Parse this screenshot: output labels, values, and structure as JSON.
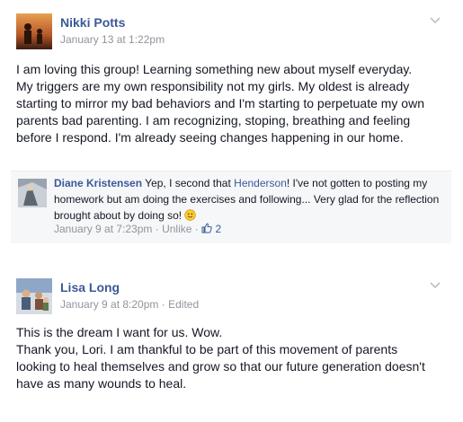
{
  "post1": {
    "author": "Nikki Potts",
    "timestamp": "January 13 at 1:22pm",
    "text_lines": [
      "I am loving this group! Learning something new about myself everyday.",
      "My triggers are my own responsibility not my girls. My oldest is already",
      "starting to mirror my bad behaviors and I'm starting to perpetuate my own",
      "parents bad parenting. I am recognizing, stoping, breathing and feeling",
      "before I respond. I'm already seeing changes happening in our home."
    ]
  },
  "comment": {
    "author": "Diane Kristensen",
    "text_before_mention": "Yep, I second that",
    "mention": "Henderson",
    "text_line1_rest": "! I've not gotten to posting",
    "text_line2": "my homework but am doing the exercises and following... Very glad for the",
    "text_line3": "reflection brought about by doing so!",
    "emoji": "smile-emoji",
    "timestamp": "January 9 at 7:23pm",
    "separator": "·",
    "unlike_label": "Unlike",
    "like_count": "2",
    "like_icon": "thumbs-up-icon"
  },
  "post2": {
    "author": "Lisa Long",
    "timestamp": "January 9 at 8:20pm",
    "separator": "·",
    "edited_label": "Edited",
    "text_lines": [
      "This is the dream I want for us. Wow.",
      "Thank you, Lori. I am thankful to be part of this movement of parents",
      "looking to heal themselves and grow so that our future generation doesn't",
      "have as many wounds to heal."
    ]
  },
  "colors": {
    "link": "#3b5998",
    "meta": "#90949c",
    "comment_bg": "#f6f7f9"
  }
}
